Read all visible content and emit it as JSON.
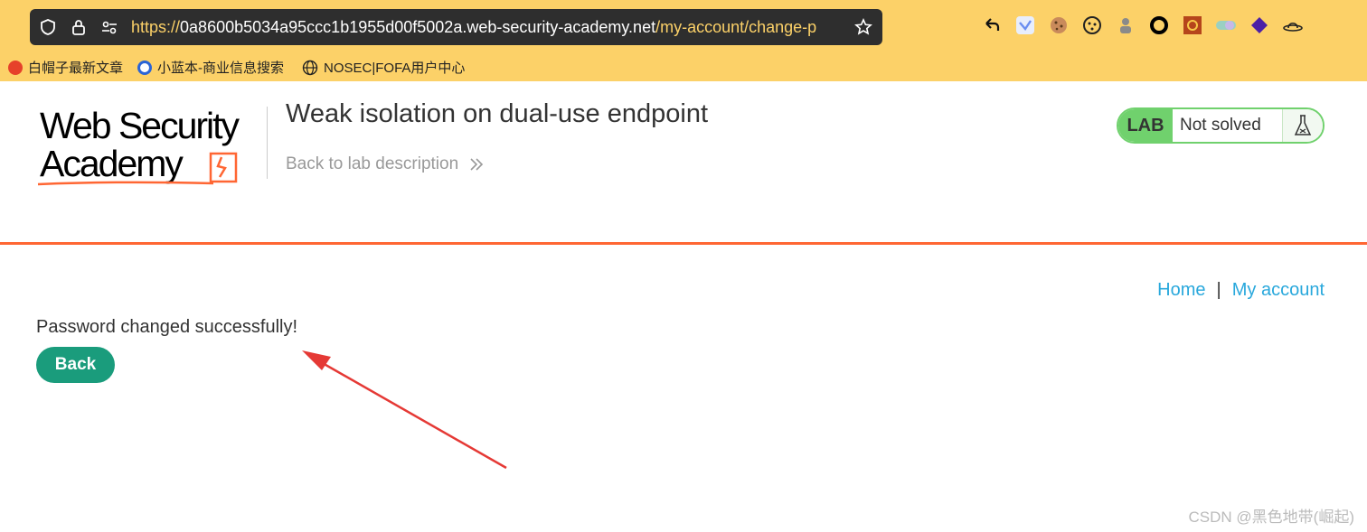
{
  "browser": {
    "url_scheme": "https://",
    "url_host": "0a8600b5034a95ccc1b1955d00f5002a.web-security-academy.net",
    "url_path": "/my-account/change-p",
    "bookmarks": [
      "白帽子最新文章",
      "小蓝本-商业信息搜索",
      "NOSEC|FOFA用户中心"
    ]
  },
  "header": {
    "logo_line1": "Web Security",
    "logo_line2": "Academy",
    "lab_title": "Weak isolation on dual-use endpoint",
    "back_link": "Back to lab description",
    "lab_tag": "LAB",
    "lab_status": "Not solved"
  },
  "nav": {
    "home": "Home",
    "separator": "|",
    "account": "My account"
  },
  "content": {
    "message": "Password changed successfully!",
    "back_button": "Back"
  },
  "watermark": "CSDN @黑色地带(崛起)",
  "colors": {
    "accent": "#ff6633",
    "button": "#1a9c7c",
    "link": "#29a8dc",
    "lab_green": "#70d16d",
    "annotation": "#e53935"
  }
}
